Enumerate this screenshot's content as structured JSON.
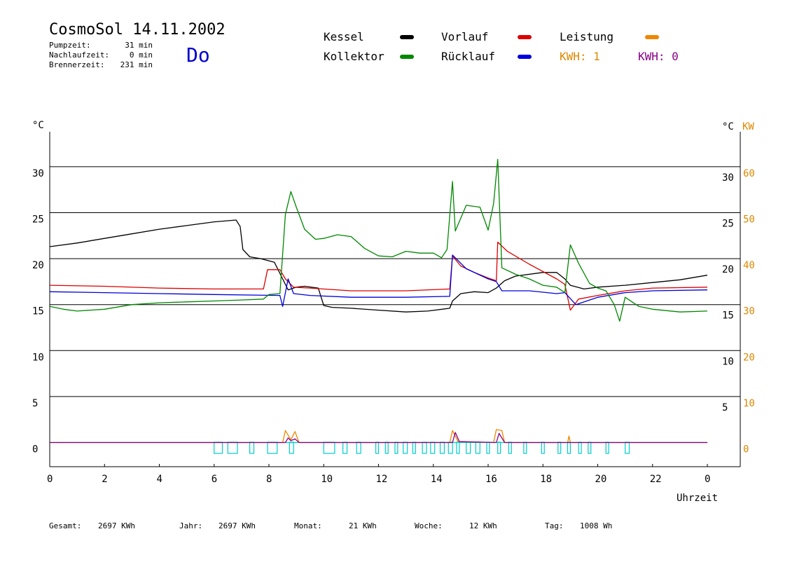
{
  "header": {
    "title": "CosmoSol 14.11.2002",
    "day": "Do",
    "stats": [
      {
        "label": "Pumpzeit:",
        "value": "31 min"
      },
      {
        "label": "Nachlaufzeit:",
        "value": "0 min"
      },
      {
        "label": "Brennerzeit:",
        "value": "231 min"
      }
    ]
  },
  "legend": [
    {
      "label": "Kessel",
      "color": "#000000"
    },
    {
      "label": "Vorlauf",
      "color": "#dd0000"
    },
    {
      "label": "Leistung",
      "color": "#ee8800"
    },
    {
      "label": "Kollektor",
      "color": "#008800"
    },
    {
      "label": "Rücklauf",
      "color": "#0000dd"
    }
  ],
  "kwh": [
    {
      "label": "KWH: 1",
      "color": "#dd8800"
    },
    {
      "label": "KWH: 0",
      "color": "#880088"
    }
  ],
  "footer": [
    {
      "label": "Gesamt:",
      "value": "2697 KWh"
    },
    {
      "label": "Jahr:",
      "value": "2697 KWh"
    },
    {
      "label": "Monat:",
      "value": "21 KWh"
    },
    {
      "label": "Woche:",
      "value": "12 KWh"
    },
    {
      "label": "Tag:",
      "value": "1008 Wh"
    }
  ],
  "chart_data": {
    "type": "line",
    "xlabel": "Uhrzeit",
    "ylabel_left": "°C",
    "ylabel_right_temp": "°C",
    "ylabel_right_power": "KW",
    "x_ticks": [
      "0",
      "2",
      "4",
      "6",
      "8",
      "10",
      "12",
      "14",
      "16",
      "18",
      "20",
      "22",
      "0"
    ],
    "xlim": [
      0,
      24
    ],
    "ylim": [
      -2.5,
      34
    ],
    "y_ticks_left": [
      0,
      5,
      10,
      15,
      20,
      25,
      30
    ],
    "y_ticks_right": [
      5,
      10,
      15,
      20,
      25,
      30
    ],
    "y_ticks_power": [
      0,
      10,
      20,
      30,
      40,
      50,
      60
    ],
    "gridlines": [
      5,
      10,
      15,
      20,
      25,
      30
    ],
    "series": [
      {
        "name": "Kessel",
        "color": "#000000",
        "points": [
          [
            0,
            21.3
          ],
          [
            1,
            21.7
          ],
          [
            2,
            22.2
          ],
          [
            3,
            22.7
          ],
          [
            4,
            23.2
          ],
          [
            5,
            23.6
          ],
          [
            6,
            24.0
          ],
          [
            6.8,
            24.2
          ],
          [
            6.95,
            23.5
          ],
          [
            7.05,
            21.0
          ],
          [
            7.3,
            20.2
          ],
          [
            7.7,
            20.0
          ],
          [
            8.2,
            19.6
          ],
          [
            8.5,
            17.8
          ],
          [
            8.7,
            16.6
          ],
          [
            9.0,
            16.9
          ],
          [
            9.3,
            17.0
          ],
          [
            9.8,
            16.8
          ],
          [
            10.0,
            14.9
          ],
          [
            10.3,
            14.7
          ],
          [
            11,
            14.6
          ],
          [
            12,
            14.4
          ],
          [
            13,
            14.2
          ],
          [
            13.8,
            14.3
          ],
          [
            14.6,
            14.6
          ],
          [
            14.7,
            15.4
          ],
          [
            15.0,
            16.2
          ],
          [
            15.5,
            16.4
          ],
          [
            16.0,
            16.3
          ],
          [
            16.3,
            16.8
          ],
          [
            16.6,
            17.6
          ],
          [
            17.0,
            18.1
          ],
          [
            18.0,
            18.5
          ],
          [
            18.5,
            18.5
          ],
          [
            18.8,
            17.8
          ],
          [
            19.0,
            17.1
          ],
          [
            19.5,
            16.7
          ],
          [
            20.0,
            16.9
          ],
          [
            21.0,
            17.1
          ],
          [
            22.0,
            17.4
          ],
          [
            23.0,
            17.7
          ],
          [
            24.0,
            18.2
          ]
        ]
      },
      {
        "name": "Vorlauf",
        "color": "#dd0000",
        "points": [
          [
            0,
            17.1
          ],
          [
            2,
            17.0
          ],
          [
            4,
            16.8
          ],
          [
            6,
            16.7
          ],
          [
            7.8,
            16.7
          ],
          [
            7.95,
            18.8
          ],
          [
            8.4,
            18.8
          ],
          [
            8.6,
            17.8
          ],
          [
            8.9,
            16.9
          ],
          [
            9.5,
            16.8
          ],
          [
            11,
            16.5
          ],
          [
            13,
            16.5
          ],
          [
            14.6,
            16.7
          ],
          [
            14.7,
            20.3
          ],
          [
            15.0,
            19.2
          ],
          [
            15.5,
            18.5
          ],
          [
            16.0,
            17.9
          ],
          [
            16.3,
            17.6
          ],
          [
            16.35,
            21.8
          ],
          [
            16.7,
            20.8
          ],
          [
            17.5,
            19.4
          ],
          [
            18.5,
            17.8
          ],
          [
            18.8,
            17.2
          ],
          [
            19.0,
            14.4
          ],
          [
            19.3,
            15.6
          ],
          [
            20.0,
            16.0
          ],
          [
            21.0,
            16.5
          ],
          [
            22.0,
            16.8
          ],
          [
            24.0,
            16.9
          ]
        ]
      },
      {
        "name": "Rücklauf",
        "color": "#0000dd",
        "points": [
          [
            0,
            16.4
          ],
          [
            2,
            16.3
          ],
          [
            4,
            16.2
          ],
          [
            6,
            16.1
          ],
          [
            8.4,
            16.0
          ],
          [
            8.5,
            14.8
          ],
          [
            8.7,
            17.8
          ],
          [
            8.9,
            16.2
          ],
          [
            9.5,
            16.0
          ],
          [
            11,
            15.8
          ],
          [
            13,
            15.8
          ],
          [
            14.6,
            15.9
          ],
          [
            14.7,
            20.4
          ],
          [
            15.2,
            18.9
          ],
          [
            16.0,
            17.8
          ],
          [
            16.3,
            17.5
          ],
          [
            16.5,
            16.5
          ],
          [
            17.5,
            16.5
          ],
          [
            18.5,
            16.2
          ],
          [
            18.8,
            16.3
          ],
          [
            19.2,
            15.0
          ],
          [
            20.0,
            15.8
          ],
          [
            21.0,
            16.3
          ],
          [
            22.0,
            16.5
          ],
          [
            24.0,
            16.6
          ]
        ]
      },
      {
        "name": "Kollektor",
        "color": "#008800",
        "points": [
          [
            0,
            14.8
          ],
          [
            0.5,
            14.5
          ],
          [
            1,
            14.3
          ],
          [
            2,
            14.5
          ],
          [
            3,
            15.0
          ],
          [
            4,
            15.2
          ],
          [
            5,
            15.3
          ],
          [
            6,
            15.4
          ],
          [
            7,
            15.5
          ],
          [
            7.8,
            15.6
          ],
          [
            8.0,
            16.1
          ],
          [
            8.4,
            16.2
          ],
          [
            8.6,
            24.8
          ],
          [
            8.8,
            27.3
          ],
          [
            9.0,
            25.6
          ],
          [
            9.3,
            23.2
          ],
          [
            9.7,
            22.1
          ],
          [
            10.0,
            22.2
          ],
          [
            10.5,
            22.6
          ],
          [
            11.0,
            22.4
          ],
          [
            11.5,
            21.1
          ],
          [
            12.0,
            20.3
          ],
          [
            12.5,
            20.2
          ],
          [
            13.0,
            20.8
          ],
          [
            13.5,
            20.6
          ],
          [
            14.0,
            20.6
          ],
          [
            14.3,
            20.1
          ],
          [
            14.5,
            21.0
          ],
          [
            14.7,
            28.4
          ],
          [
            14.8,
            23.0
          ],
          [
            15.2,
            25.8
          ],
          [
            15.7,
            25.6
          ],
          [
            16.0,
            23.1
          ],
          [
            16.2,
            26.0
          ],
          [
            16.35,
            30.8
          ],
          [
            16.5,
            19.0
          ],
          [
            17.0,
            18.3
          ],
          [
            17.5,
            17.8
          ],
          [
            18.0,
            17.1
          ],
          [
            18.5,
            16.9
          ],
          [
            18.8,
            16.3
          ],
          [
            19.0,
            21.5
          ],
          [
            19.3,
            19.5
          ],
          [
            19.7,
            17.3
          ],
          [
            20.0,
            16.8
          ],
          [
            20.3,
            16.5
          ],
          [
            20.6,
            15.0
          ],
          [
            20.8,
            13.2
          ],
          [
            21.0,
            15.8
          ],
          [
            21.5,
            14.8
          ],
          [
            22.0,
            14.5
          ],
          [
            23.0,
            14.2
          ],
          [
            24.0,
            14.3
          ]
        ]
      },
      {
        "name": "Leistung",
        "color": "#ee8800",
        "points": [
          [
            0,
            0
          ],
          [
            8.5,
            0
          ],
          [
            8.6,
            1.3
          ],
          [
            8.8,
            0.3
          ],
          [
            8.95,
            1.2
          ],
          [
            9.1,
            0
          ],
          [
            14.6,
            0
          ],
          [
            14.7,
            1.3
          ],
          [
            14.9,
            0.1
          ],
          [
            16.2,
            0
          ],
          [
            16.3,
            1.4
          ],
          [
            16.5,
            1.3
          ],
          [
            16.6,
            0
          ],
          [
            18.9,
            0
          ],
          [
            18.95,
            0.7
          ],
          [
            19.0,
            0
          ],
          [
            24,
            0
          ]
        ]
      },
      {
        "name": "KWH: 0",
        "color": "#880088",
        "points": [
          [
            0,
            0
          ],
          [
            8.6,
            0
          ],
          [
            8.7,
            0.5
          ],
          [
            8.8,
            0.2
          ],
          [
            8.95,
            0.4
          ],
          [
            9.1,
            0
          ],
          [
            14.7,
            0
          ],
          [
            14.8,
            1.1
          ],
          [
            14.95,
            0.1
          ],
          [
            16.3,
            0
          ],
          [
            16.4,
            1.0
          ],
          [
            16.6,
            0
          ],
          [
            24,
            0
          ]
        ]
      }
    ],
    "pump": {
      "name": "Pumpe",
      "color": "#00cccc",
      "baseline": 0,
      "pulses": [
        [
          6.0,
          6.3
        ],
        [
          6.5,
          6.85
        ],
        [
          7.3,
          7.45
        ],
        [
          7.95,
          8.3
        ],
        [
          8.75,
          8.9
        ],
        [
          10.0,
          10.4
        ],
        [
          10.7,
          10.85
        ],
        [
          11.2,
          11.35
        ],
        [
          11.9,
          12.0
        ],
        [
          12.25,
          12.35
        ],
        [
          12.6,
          12.7
        ],
        [
          12.9,
          13.05
        ],
        [
          13.25,
          13.35
        ],
        [
          13.6,
          13.75
        ],
        [
          13.9,
          14.05
        ],
        [
          14.25,
          14.4
        ],
        [
          14.55,
          14.7
        ],
        [
          14.85,
          14.95
        ],
        [
          15.2,
          15.35
        ],
        [
          15.55,
          15.7
        ],
        [
          15.95,
          16.05
        ],
        [
          16.35,
          16.45
        ],
        [
          16.75,
          16.85
        ],
        [
          17.3,
          17.4
        ],
        [
          17.95,
          18.05
        ],
        [
          18.55,
          18.65
        ],
        [
          18.9,
          19.0
        ],
        [
          19.3,
          19.4
        ],
        [
          19.65,
          19.75
        ],
        [
          20.3,
          20.4
        ],
        [
          21.0,
          21.15
        ]
      ]
    }
  }
}
